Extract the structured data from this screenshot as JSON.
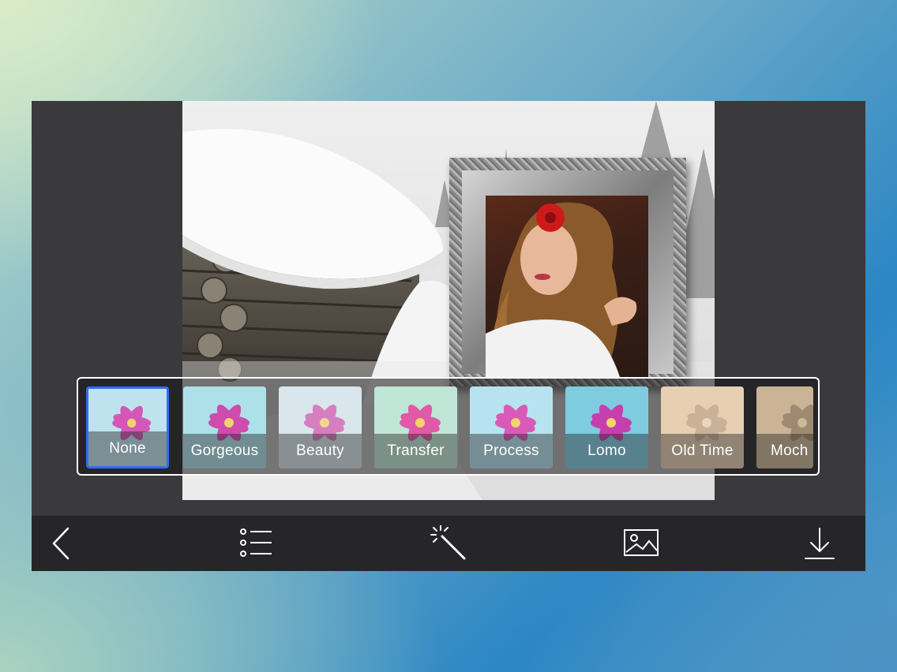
{
  "filters": [
    {
      "label": "None",
      "selected": true,
      "tint": "#bfe3ee"
    },
    {
      "label": "Gorgeous",
      "selected": false,
      "tint": "#aee0ea"
    },
    {
      "label": "Beauty",
      "selected": false,
      "tint": "#d9e6ec"
    },
    {
      "label": "Transfer",
      "selected": false,
      "tint": "#bfe6d6"
    },
    {
      "label": "Process",
      "selected": false,
      "tint": "#b7e3f0"
    },
    {
      "label": "Lomo",
      "selected": false,
      "tint": "#7fcbe0"
    },
    {
      "label": "Old Time",
      "selected": false,
      "tint": "#e7cfb2"
    },
    {
      "label": "Moch",
      "selected": false,
      "tint": "#cbb496"
    }
  ],
  "toolbar": {
    "items": [
      {
        "icon": "back-chevron-icon"
      },
      {
        "icon": "frame-list-icon"
      },
      {
        "icon": "magic-wand-icon"
      },
      {
        "icon": "gallery-image-icon"
      },
      {
        "icon": "download-icon"
      }
    ]
  },
  "colors": {
    "selection": "#2f6ff0",
    "device": "#3a3a3c",
    "toolbar": "#262628"
  }
}
